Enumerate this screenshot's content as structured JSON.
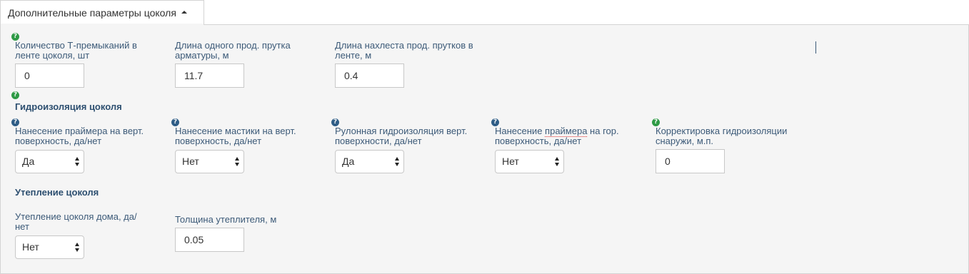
{
  "tab": {
    "label": "Дополнительные параметры цоколя"
  },
  "row1": {
    "t_junctions": {
      "label": "Количество Т-премыканий в ленте цоколя, шт",
      "value": "0"
    },
    "rebar_length": {
      "label": "Длина одного прод. прутка арматуры, м",
      "value": "11.7"
    },
    "overlap_length": {
      "label": "Длина нахлеста прод. прутков в ленте, м",
      "value": "0.4"
    }
  },
  "waterproofing": {
    "title": "Гидроизоляция цоколя",
    "primer_vert": {
      "label": "Нанесение праймера на верт. поверхность, да/нет",
      "value": "Да"
    },
    "mastic_vert": {
      "label": "Нанесение мастики на верт. поверхность, да/нет",
      "value": "Нет"
    },
    "roll_vert": {
      "label": "Рулонная гидроизоляция верт. поверхности, да/нет",
      "value": "Да"
    },
    "primer_horiz": {
      "label_before": "Нанесение ",
      "label_marked": "праймера",
      "label_after": " на гор. поверхность, да/нет",
      "value": "Нет"
    },
    "outside_correction": {
      "label": "Корректировка гидроизоляции снаружи, м.п.",
      "value": "0"
    }
  },
  "insulation": {
    "title": "Утепление цоколя",
    "plinth_insulation": {
      "label": "Утепление цоколя дома, да/нет",
      "value": "Нет"
    },
    "thickness": {
      "label": "Толщина утеплителя, м",
      "value": "0.05"
    }
  },
  "help_glyph": "?",
  "colors": {
    "help_green": "#2e9a45",
    "help_blue": "#2f5d86",
    "label": "#3c5a78",
    "panel_bg": "#f5f5f5"
  }
}
